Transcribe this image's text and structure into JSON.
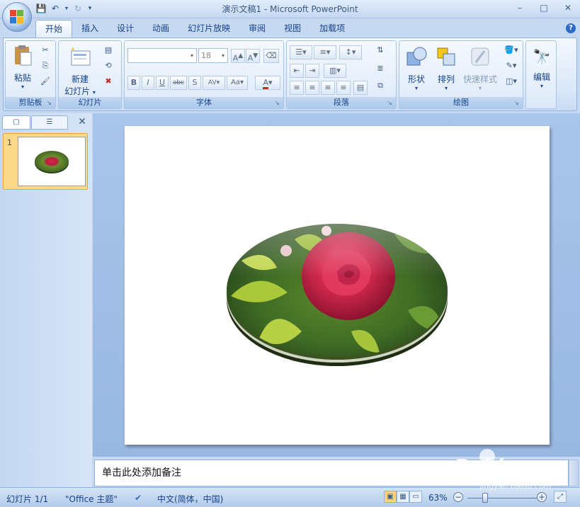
{
  "window": {
    "title": "演示文稿1 - Microsoft PowerPoint",
    "controls": [
      "–",
      "□",
      "✕"
    ]
  },
  "ribbon_tabs": [
    "开始",
    "插入",
    "设计",
    "动画",
    "幻灯片放映",
    "审阅",
    "视图",
    "加载项"
  ],
  "ribbon": {
    "clipboard": {
      "label": "剪贴板",
      "paste": "粘贴"
    },
    "slides": {
      "label": "幻灯片",
      "new_slide_line1": "新建",
      "new_slide_line2": "幻灯片"
    },
    "font": {
      "label": "字体",
      "font_size": "18",
      "font_name": ""
    },
    "paragraph": {
      "label": "段落"
    },
    "drawing": {
      "label": "绘图",
      "shapes": "形状",
      "arrange": "排列",
      "quick_styles": "快速样式"
    },
    "editing": {
      "label": "编辑"
    }
  },
  "left_pane": {
    "slide_number": "1"
  },
  "notes": {
    "placeholder": "单击此处添加备注"
  },
  "status_bar": {
    "slide_info": "幻灯片 1/1",
    "theme": "\"Office 主题\"",
    "language": "中文(简体，中国)",
    "zoom": "63%"
  },
  "watermark": {
    "text1": "Baidu",
    "text2": "经验",
    "url": "jingyan.baidu.com"
  }
}
